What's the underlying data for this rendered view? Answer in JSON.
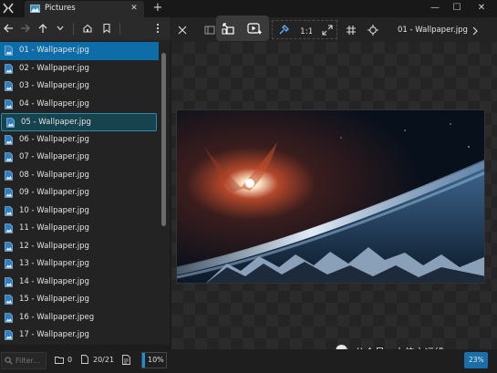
{
  "tab": {
    "title": "Pictures"
  },
  "files": [
    "01 - Wallpaper.jpg",
    "02 - Wallpaper.jpg",
    "03 - Wallpaper.jpg",
    "04 - Wallpaper.jpg",
    "05 - Wallpaper.jpg",
    "06 - Wallpaper.jpg",
    "07 - Wallpaper.jpg",
    "08 - Wallpaper.jpg",
    "09 - Wallpaper.jpg",
    "10 - Wallpaper.jpg",
    "11 - Wallpaper.jpg",
    "12 - Wallpaper.jpg",
    "13 - Wallpaper.jpg",
    "14 - Wallpaper.jpg",
    "15 - Wallpaper.jpg",
    "16 - Wallpaper.jpeg",
    "17 - Wallpaper.jpg"
  ],
  "selected_index": 0,
  "current_index": 4,
  "status": {
    "filter_placeholder": "Filter...",
    "folder_count": "0",
    "file_count": "20/21",
    "zoom_left": "10%",
    "zoom_left_fraction": 0.1,
    "zoom_right": "23%"
  },
  "viewer": {
    "file_title": "01 - Wallpaper.jpg"
  },
  "watermark": {
    "text": "公众号 · 大侠之运维"
  },
  "colors": {
    "accent": "#0d6da8",
    "current_row": "#17434f",
    "background": "#1c1c1c"
  }
}
